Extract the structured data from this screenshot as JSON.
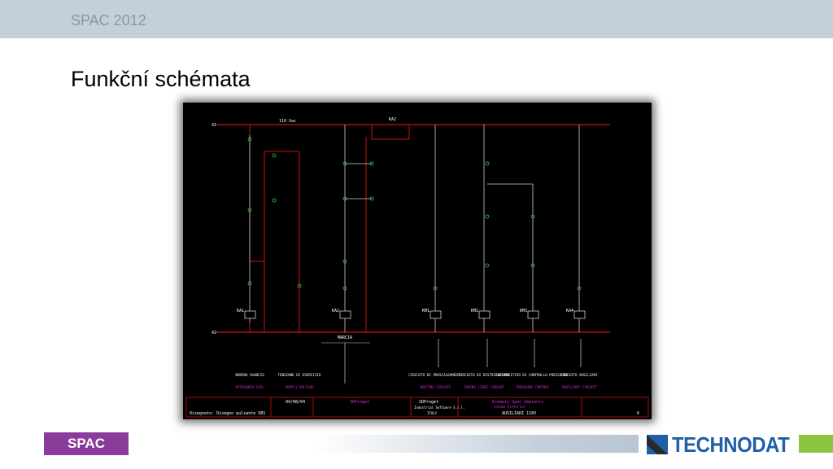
{
  "header": {
    "title": "SPAC 2012"
  },
  "slide": {
    "title": "Funkční schémata"
  },
  "schematic": {
    "voltage": "110 Vac",
    "relays": [
      "KA1",
      "KA2",
      "KM1",
      "KM2",
      "KM3",
      "KA4"
    ],
    "sections": [
      {
        "title": "BOBINA SGANCIO",
        "sub": "OPTOGANCH COIL"
      },
      {
        "title": "TENSIONE DI ESERCIZIO",
        "sub": "SUPPLY VOLTAGE"
      },
      {
        "title": "CIRCUITO DI PRESCALDAMENTO",
        "sub": "HEATING CIRCUIT"
      },
      {
        "title": "CIRCUITO DI DISTRIBUZIONE",
        "sub": "TAKING LIGHT CIRCUIT"
      },
      {
        "title": "DISPOSITIVO DI CONTROLLO PRESSIONE",
        "sub": "PRESSURE CONTROL"
      },
      {
        "title": "CIRCUITO AUSILIARI",
        "sub": "AUXILIARY CIRCUIT"
      }
    ],
    "marcia": "MARCIA",
    "titleblock": {
      "date": "04/08/04",
      "company": "SDProget",
      "company2": "SDProget",
      "company_sub": "Industrial Software S.r.l.",
      "country": "ITALY",
      "project": "Esempio Spac Impianti",
      "project_sub": "Schema Elettrico",
      "sheet_title": "AUSILIARI 110V",
      "drawn": "Disegnato: Disegno pulsante SB1",
      "sheet_no": "6"
    }
  },
  "footer": {
    "badge": "SPAC",
    "logo": "TECHNODAT"
  }
}
